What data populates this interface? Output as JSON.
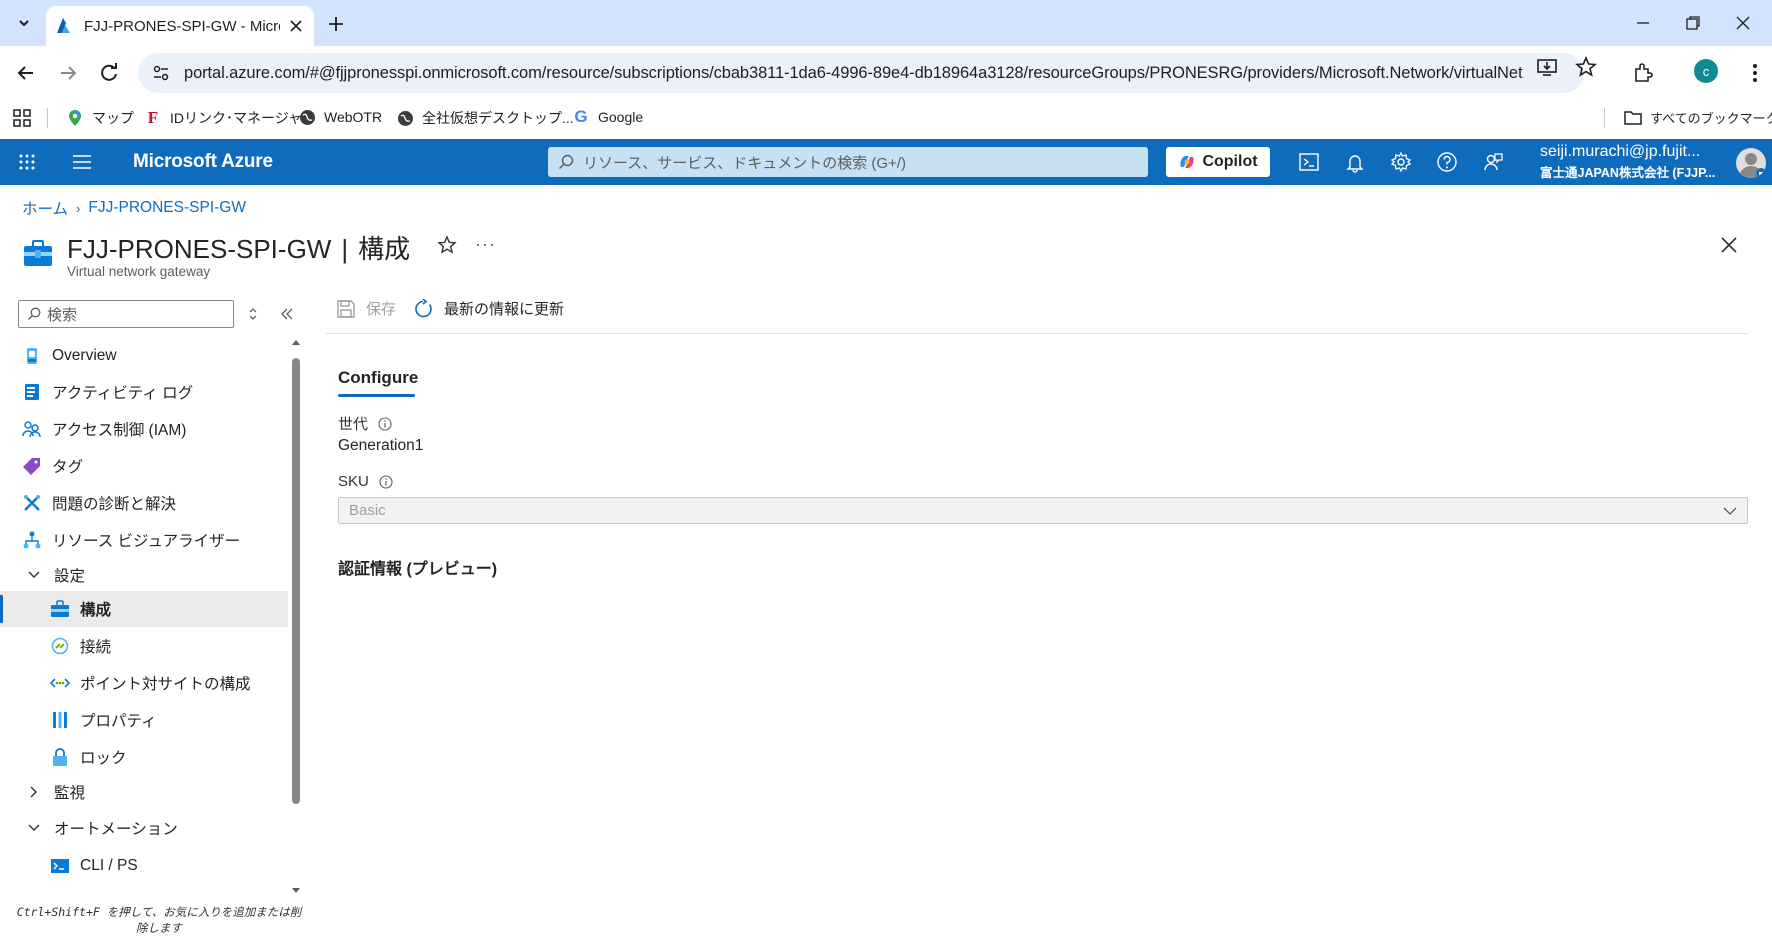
{
  "browser": {
    "tab_title": "FJJ-PRONES-SPI-GW - Microsoft Azure",
    "url": "portal.azure.com/#@fjjpronesspi.onmicrosoft.com/resource/subscriptions/cbab3811-1da6-4996-89e4-db18964a3128/resourceGroups/PRONESRG/providers/Microsoft.Network/virtualNet...",
    "profile_initial": "c",
    "bookmarks": [
      {
        "label": "マップ",
        "icon": "maps-pin-icon"
      },
      {
        "label": "IDリンク･マネージャー",
        "icon": "f-logo-icon"
      },
      {
        "label": "WebOTR",
        "icon": "globe-icon"
      },
      {
        "label": "全社仮想デスクトップ...",
        "icon": "globe-icon"
      },
      {
        "label": "Google",
        "icon": "google-icon"
      }
    ],
    "all_bookmarks": "すべてのブックマーク"
  },
  "azure": {
    "brand": "Microsoft Azure",
    "search_placeholder": "リソース、サービス、ドキュメントの検索 (G+/)",
    "copilot": "Copilot",
    "account_email": "seiji.murachi@jp.fujit...",
    "account_org": "富士通JAPAN株式会社 (FJJP..."
  },
  "breadcrumb": {
    "home": "ホーム",
    "resource": "FJJ-PRONES-SPI-GW"
  },
  "resource": {
    "name": "FJJ-PRONES-SPI-GW",
    "pipe": "|",
    "page": "構成",
    "type": "Virtual network gateway",
    "more": "···"
  },
  "nav": {
    "search_placeholder": "検索",
    "items": [
      {
        "label": "Overview"
      },
      {
        "label": "アクティビティ ログ"
      },
      {
        "label": "アクセス制御 (IAM)"
      },
      {
        "label": "タグ"
      },
      {
        "label": "問題の診断と解決"
      },
      {
        "label": "リソース ビジュアライザー"
      },
      {
        "label": "設定"
      },
      {
        "label": "構成"
      },
      {
        "label": "接続"
      },
      {
        "label": "ポイント対サイトの構成"
      },
      {
        "label": "プロパティ"
      },
      {
        "label": "ロック"
      },
      {
        "label": "監視"
      },
      {
        "label": "オートメーション"
      },
      {
        "label": "CLI / PS"
      }
    ],
    "hint": "Ctrl+Shift+F を押して、お気に入りを追加または削除します"
  },
  "command_bar": {
    "save": "保存",
    "refresh": "最新の情報に更新"
  },
  "content": {
    "tab": "Configure",
    "generation_label": "世代",
    "generation_value": "Generation1",
    "sku_label": "SKU",
    "sku_value": "Basic",
    "auth_heading": "認証情報 (プレビュー)"
  },
  "colors": {
    "azure_blue": "#0f6cbd",
    "chrome_tabstrip": "#d3e3fd"
  }
}
